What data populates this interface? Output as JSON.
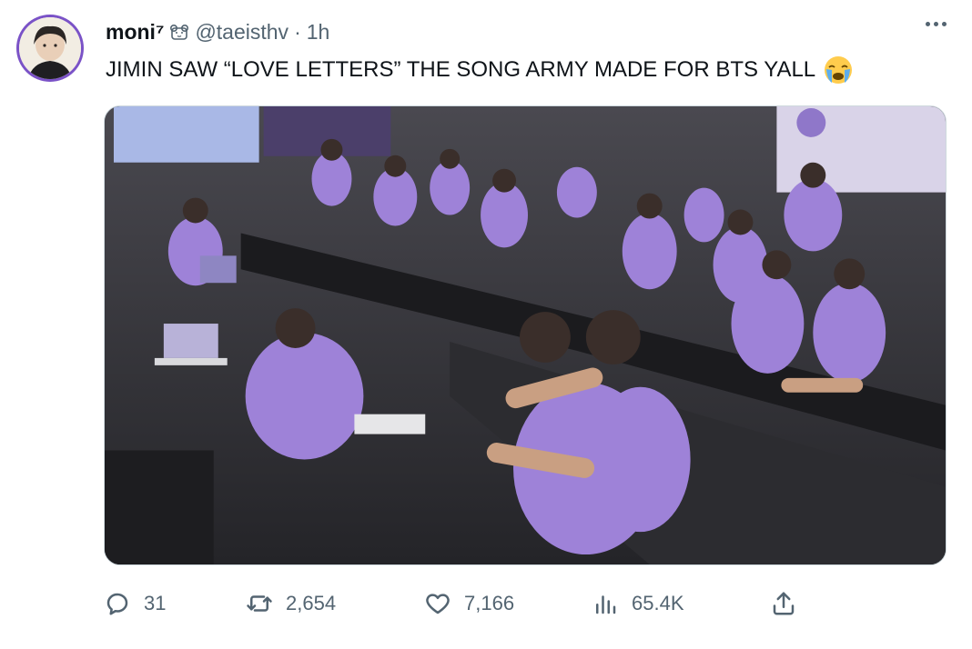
{
  "author": {
    "display_name": "moni⁷",
    "handle": "@taeisthv",
    "separator": "·",
    "time": "1h",
    "avatar_ring_color": "#7a52c7"
  },
  "tweet": {
    "text": "JIMIN SAW “LOVE LETTERS” THE SONG ARMY MADE FOR BTS YALL",
    "emoji": "loudly-crying-face-icon"
  },
  "media": {
    "description_icon": "photo",
    "accent": "#9b7fd6"
  },
  "actions": {
    "replies": "31",
    "retweets": "2,654",
    "likes": "7,166",
    "views": "65.4K"
  },
  "icons": {
    "reply": "reply-icon",
    "retweet": "retweet-icon",
    "like": "heart-icon",
    "views": "views-icon",
    "share": "share-icon",
    "more": "more-icon"
  }
}
